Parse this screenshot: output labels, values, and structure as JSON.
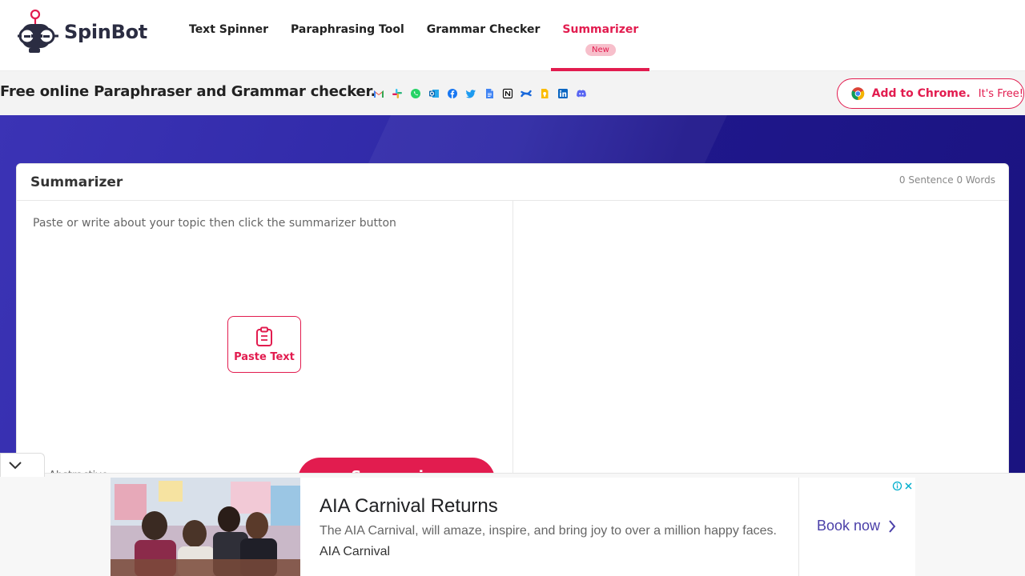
{
  "header": {
    "logo_text": "SpinBot",
    "nav": [
      {
        "label": "Text Spinner"
      },
      {
        "label": "Paraphrasing Tool"
      },
      {
        "label": "Grammar Checker"
      },
      {
        "label": "Summarizer",
        "badge": "New",
        "active": true
      }
    ]
  },
  "subbar": {
    "tagline": "Free online Paraphraser and Grammar checker.",
    "app_icons": [
      "gmail-icon",
      "slack-icon",
      "whatsapp-icon",
      "outlook-icon",
      "facebook-icon",
      "twitter-icon",
      "google-docs-icon",
      "notion-icon",
      "confluence-icon",
      "google-keep-icon",
      "linkedin-icon",
      "discord-icon"
    ],
    "chrome_button": {
      "strong": "Add to Chrome.",
      "free": "It's Free!"
    }
  },
  "tool": {
    "title": "Summarizer",
    "counts": "0 Sentence 0 Words",
    "input_placeholder": "Paste or write about your topic then click the summarizer button",
    "paste_label": "Paste Text",
    "summarize_label": "Summarize",
    "mode_label": "Abstractive"
  },
  "ad": {
    "title": "AIA Carnival Returns",
    "description": "The AIA Carnival, will amaze, inspire, and bring joy to over a million happy faces.",
    "brand": "AIA Carnival",
    "cta": "Book now"
  },
  "colors": {
    "brand": "#e21c4f",
    "hero_start": "#3b33b5",
    "hero_end": "#1a1380",
    "cta_purple": "#4a3fa8"
  }
}
